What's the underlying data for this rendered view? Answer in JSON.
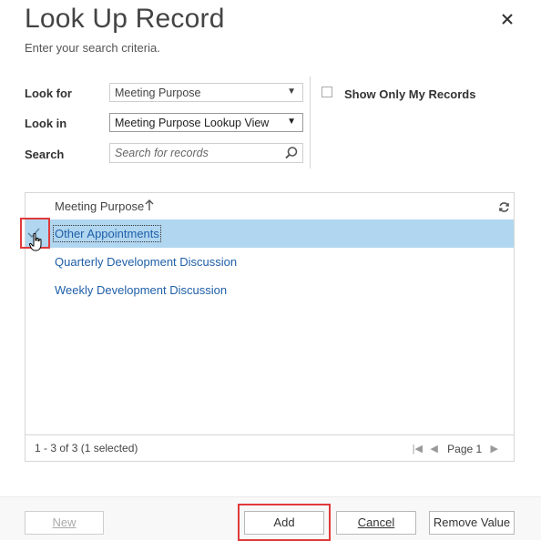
{
  "dialog": {
    "title": "Look Up Record",
    "subtitle": "Enter your search criteria."
  },
  "form": {
    "look_for_label": "Look for",
    "look_for_value": "Meeting Purpose",
    "look_in_label": "Look in",
    "look_in_value": "Meeting Purpose Lookup View",
    "search_label": "Search",
    "search_placeholder": "Search for records",
    "show_only_my_records_label": "Show Only My Records",
    "show_only_my_records_checked": false
  },
  "grid": {
    "column_header": "Meeting Purpose",
    "rows": [
      {
        "label": "Other Appointments",
        "selected": true
      },
      {
        "label": "Quarterly Development Discussion",
        "selected": false
      },
      {
        "label": "Weekly Development Discussion",
        "selected": false
      }
    ],
    "footer_count": "1 - 3 of 3 (1 selected)",
    "page_label": "Page 1"
  },
  "buttons": {
    "new_label": "New",
    "add_label": "Add",
    "cancel_label": "Cancel",
    "remove_label": "Remove Value"
  },
  "colors": {
    "selection": "#b1d6f0",
    "link": "#1f5fa8",
    "highlight": "#e03a3a"
  },
  "icons": [
    "close-icon",
    "dropdown-caret-icon",
    "search-icon",
    "sort-ascending-icon",
    "refresh-icon",
    "checkmark-icon",
    "hand-cursor-icon",
    "first-page-icon",
    "previous-page-icon",
    "next-page-icon"
  ]
}
